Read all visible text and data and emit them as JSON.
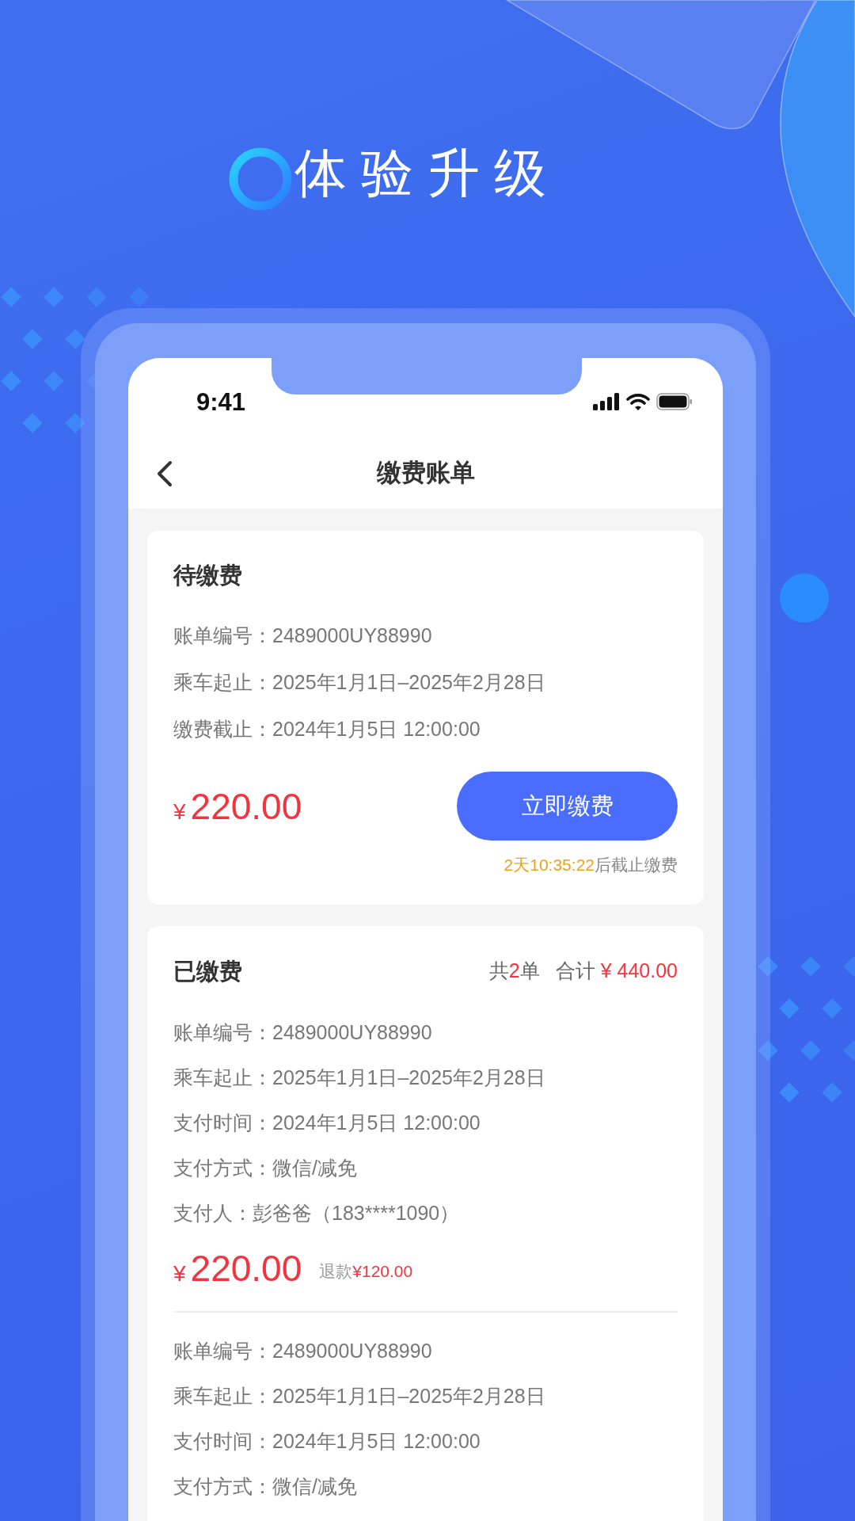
{
  "promo": {
    "headline": "体验升级"
  },
  "status_bar": {
    "time": "9:41"
  },
  "nav": {
    "title": "缴费账单"
  },
  "pending": {
    "title": "待缴费",
    "fields": [
      {
        "label": "账单编号：",
        "value": "2489000UY88990"
      },
      {
        "label": "乘车起止：",
        "value": "2025年1月1日–2025年2月28日"
      },
      {
        "label": "缴费截止：",
        "value": "2024年1月5日 12:00:00"
      }
    ],
    "currency": "¥",
    "amount": "220.00",
    "button": "立即缴费",
    "countdown": "2天10:35:22",
    "countdown_suffix": "后截止缴费"
  },
  "paid": {
    "title": "已缴费",
    "count_prefix": "共",
    "count": "2",
    "count_suffix": "单",
    "total_label": "合计",
    "total": "¥ 440.00",
    "bills": [
      {
        "fields": [
          {
            "label": "账单编号：",
            "value": "2489000UY88990"
          },
          {
            "label": "乘车起止：",
            "value": "2025年1月1日–2025年2月28日"
          },
          {
            "label": "支付时间：",
            "value": "2024年1月5日 12:00:00"
          },
          {
            "label": "支付方式：",
            "value": "微信/减免"
          },
          {
            "label": "支付人：",
            "value": "彭爸爸（183****1090）"
          }
        ],
        "currency": "¥",
        "amount": "220.00",
        "refund_label": "退款",
        "refund": "¥120.00"
      },
      {
        "fields": [
          {
            "label": "账单编号：",
            "value": "2489000UY88990"
          },
          {
            "label": "乘车起止：",
            "value": "2025年1月1日–2025年2月28日"
          },
          {
            "label": "支付时间：",
            "value": "2024年1月5日 12:00:00"
          },
          {
            "label": "支付方式：",
            "value": "微信/减免"
          }
        ]
      }
    ]
  }
}
